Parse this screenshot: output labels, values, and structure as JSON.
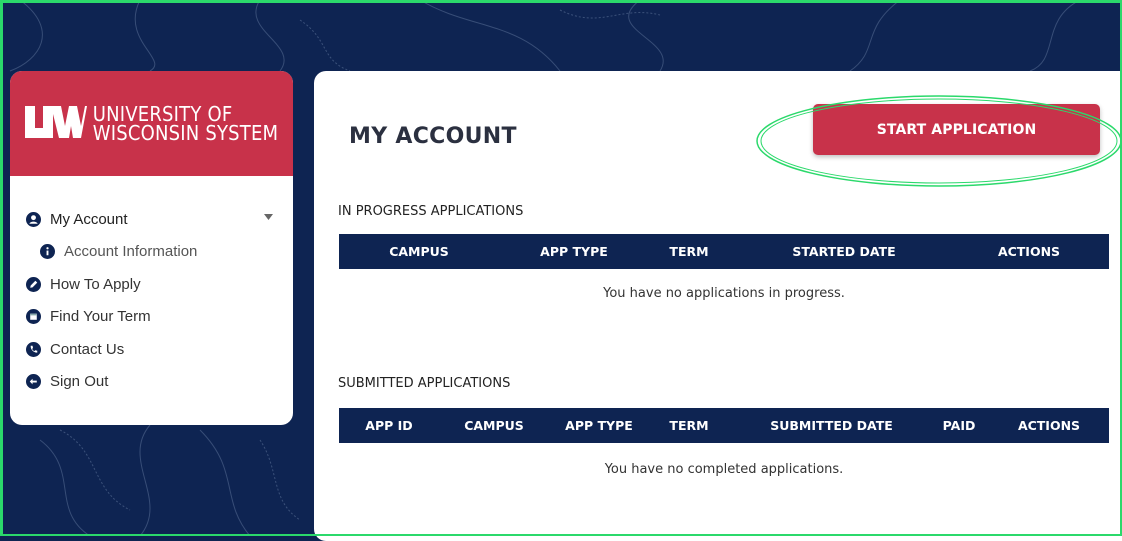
{
  "brand": {
    "logo_mark": "UW",
    "logo_line1": "UNIVERSITY OF",
    "logo_line2": "WISCONSIN SYSTEM",
    "accent_color": "#c8324a",
    "navy_color": "#0e2452"
  },
  "sidebar": {
    "items": [
      {
        "label": "My Account",
        "icon": "user-circle-icon",
        "active": true,
        "has_chevron": true
      },
      {
        "label": "Account Information",
        "icon": "info-circle-icon",
        "sub": true
      },
      {
        "label": "How To Apply",
        "icon": "edit-circle-icon"
      },
      {
        "label": "Find Your Term",
        "icon": "calendar-circle-icon"
      },
      {
        "label": "Contact Us",
        "icon": "phone-circle-icon"
      },
      {
        "label": "Sign Out",
        "icon": "sign-out-circle-icon"
      }
    ]
  },
  "main": {
    "title": "MY ACCOUNT",
    "start_button": "START APPLICATION",
    "in_progress": {
      "heading": "IN PROGRESS APPLICATIONS",
      "columns": [
        "CAMPUS",
        "APP TYPE",
        "TERM",
        "STARTED DATE",
        "ACTIONS"
      ],
      "empty_text": "You have no applications in progress."
    },
    "submitted": {
      "heading": "SUBMITTED APPLICATIONS",
      "columns": [
        "APP ID",
        "CAMPUS",
        "APP TYPE",
        "TERM",
        "SUBMITTED DATE",
        "PAID",
        "ACTIONS"
      ],
      "empty_text": "You have no completed applications."
    }
  }
}
